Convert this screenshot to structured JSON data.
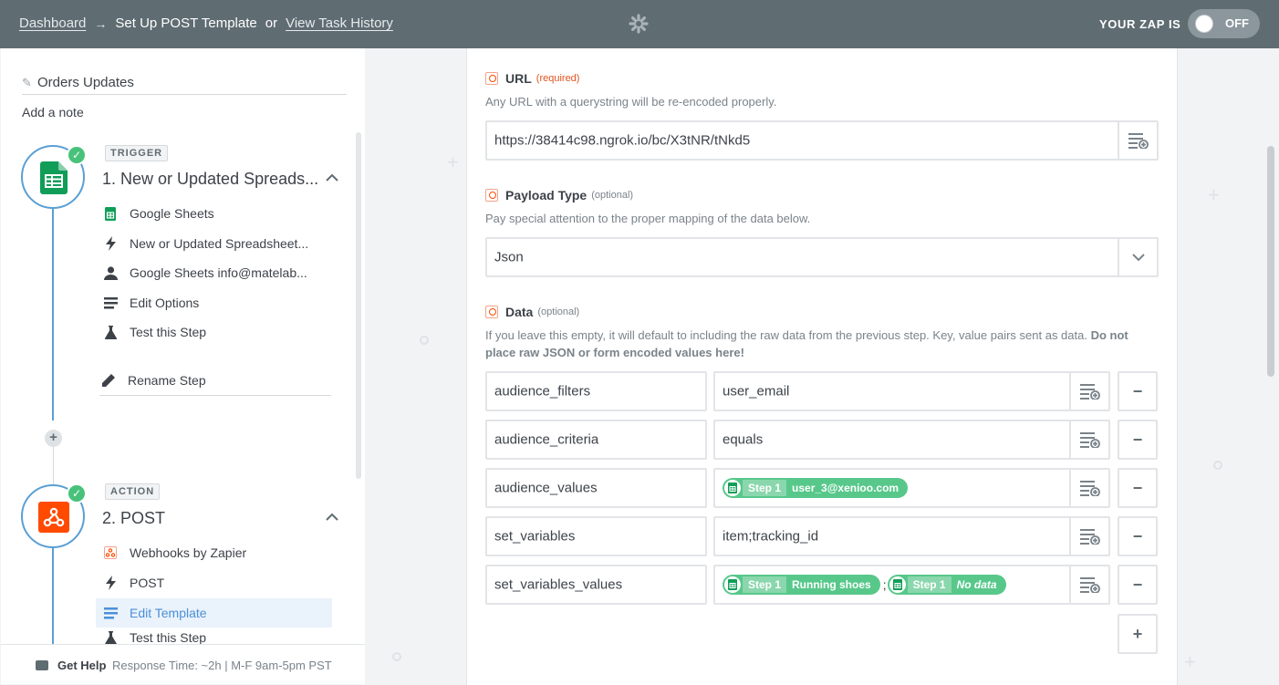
{
  "header": {
    "dashboard": "Dashboard",
    "arrow": "→",
    "current": "Set Up POST Template",
    "or": "or",
    "history": "View Task History",
    "zap_is": "YOUR ZAP IS",
    "toggle_state": "OFF"
  },
  "sidebar": {
    "zap_name": "Orders Updates",
    "add_note": "Add a note",
    "trigger": {
      "badge": "TRIGGER",
      "title": "1. New or Updated Spreads...",
      "items": [
        {
          "label": "Google Sheets",
          "icon": "google-sheets-icon"
        },
        {
          "label": "New or Updated Spreadsheet...",
          "icon": "lightning-icon"
        },
        {
          "label": "Google Sheets info@matelab...",
          "icon": "user-icon"
        },
        {
          "label": "Edit Options",
          "icon": "list-icon"
        },
        {
          "label": "Test this Step",
          "icon": "flask-icon"
        }
      ],
      "rename": "Rename Step"
    },
    "action": {
      "badge": "ACTION",
      "title": "2. POST",
      "items": [
        {
          "label": "Webhooks by Zapier",
          "icon": "webhook-icon"
        },
        {
          "label": "POST",
          "icon": "lightning-icon"
        },
        {
          "label": "Edit Template",
          "icon": "list-icon"
        },
        {
          "label": "Test this Step",
          "icon": "flask-icon"
        }
      ]
    },
    "help": {
      "label": "Get Help",
      "response": "Response Time: ~2h  |  M-F 9am-5pm PST"
    }
  },
  "form": {
    "url": {
      "label": "URL",
      "req": "(required)",
      "help": "Any URL with a querystring will be re-encoded properly.",
      "value": "https://38414c98.ngrok.io/bc/X3tNR/tNkd5"
    },
    "payload": {
      "label": "Payload Type",
      "opt": "(optional)",
      "help": "Pay special attention to the proper mapping of the data below.",
      "value": "Json"
    },
    "data": {
      "label": "Data",
      "opt": "(optional)",
      "help_plain": "If you leave this empty, it will default to including the raw data from the previous step. Key, value pairs sent as data.",
      "help_bold": "Do not place raw JSON or form encoded values here!",
      "rows": [
        {
          "key": "audience_filters",
          "value": "user_email"
        },
        {
          "key": "audience_criteria",
          "value": "equals"
        },
        {
          "key": "audience_values",
          "pill_step": "Step 1",
          "pill_value": "user_3@xenioo.com"
        },
        {
          "key": "set_variables",
          "value": "item;tracking_id"
        },
        {
          "key": "set_variables_values",
          "pill_step": "Step 1",
          "pill_value": "Running shoes",
          "sep": ";",
          "pill2_step": "Step 1",
          "pill2_value": "No data"
        }
      ]
    }
  },
  "colors": {
    "topbar": "#5f6c72",
    "accent_blue": "#5a9fd4",
    "success_green": "#48c27b",
    "pill_green": "#57c88a",
    "zapier_orange": "#ff4a00"
  }
}
